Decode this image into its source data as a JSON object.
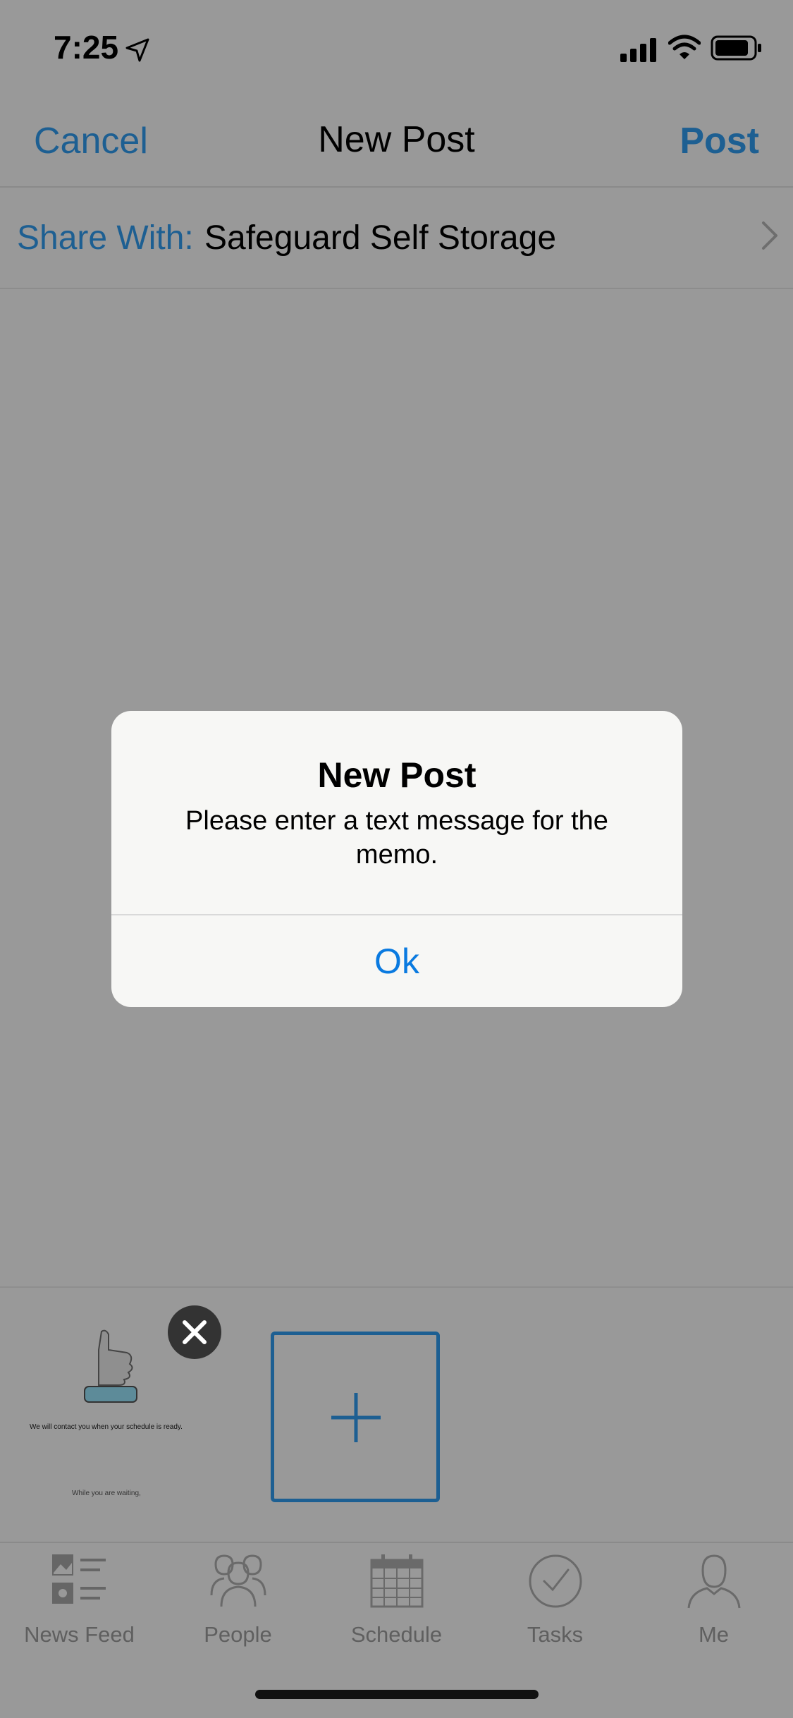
{
  "status_bar": {
    "time": "7:25"
  },
  "nav": {
    "cancel_label": "Cancel",
    "title": "New Post",
    "post_label": "Post"
  },
  "share": {
    "label": "Share With:",
    "value": "Safeguard Self Storage"
  },
  "attachment": {
    "caption": "We will contact you when your schedule is ready.",
    "caption2": "While you are waiting,"
  },
  "tabs": [
    {
      "label": "News Feed",
      "icon": "news-feed-icon"
    },
    {
      "label": "People",
      "icon": "people-icon"
    },
    {
      "label": "Schedule",
      "icon": "calendar-icon"
    },
    {
      "label": "Tasks",
      "icon": "checkmark-icon"
    },
    {
      "label": "Me",
      "icon": "person-icon"
    }
  ],
  "alert": {
    "title": "New Post",
    "message": "Please enter a text message for the memo.",
    "ok_label": "Ok"
  },
  "colors": {
    "accent": "#1d5f92",
    "alert_button": "#0a7ae0",
    "overlay": "#999999"
  }
}
